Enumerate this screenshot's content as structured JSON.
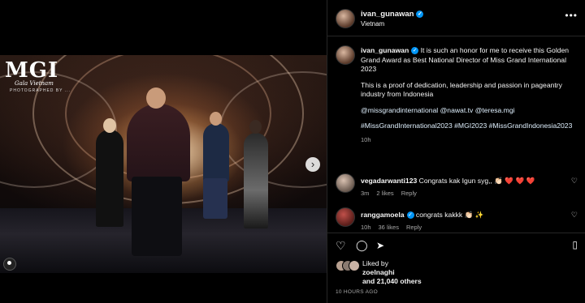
{
  "post": {
    "logo_main": "MGI",
    "logo_sub": "Gala Vietnam",
    "logo_sub2": "PHOTOGRAPHED BY ..."
  },
  "header": {
    "username": "ivan_gunawan",
    "location": "Vietnam"
  },
  "caption": {
    "username": "ivan_gunawan",
    "paragraph1": "It is such an honor for me to receive this Golden Grand Award as Best National Director of Miss Grand International 2023",
    "paragraph2": "This is a proof of dedication, leadership and passion in pageantry industry from Indonesia",
    "mentions": "@missgrandinternational @nawat.tv @teresa.mgi",
    "hashtags": "#MissGrandInternational2023 #MGI2023 #MissGrandIndonesia2023",
    "time": "10h"
  },
  "comments": [
    {
      "username": "vegadarwanti123",
      "text": "Congrats kak Igun syg,,",
      "emoji": "👏🏻 ❤️ ❤️ ❤️",
      "time": "3m",
      "likes": "2 likes",
      "reply": "Reply"
    },
    {
      "username": "ranggamoela",
      "text": "congrats kakkk",
      "emoji": "👏🏻 ✨",
      "time": "10h",
      "likes": "36 likes",
      "reply": "Reply"
    }
  ],
  "likes": {
    "prefix": "Liked by",
    "user": "zoelnaghi",
    "count_text": "and 21,040 others"
  },
  "posted_ago": "10 HOURS AGO",
  "icons": [
    "verified-icon",
    "more-icon",
    "heart-icon",
    "comment-icon",
    "share-icon",
    "bookmark-icon",
    "carousel-next-icon",
    "tag-icon"
  ],
  "colors": {
    "verified": "#0095f6",
    "background": "#000000",
    "muted": "#a8a8a8",
    "heart_red": "#ff3040"
  }
}
